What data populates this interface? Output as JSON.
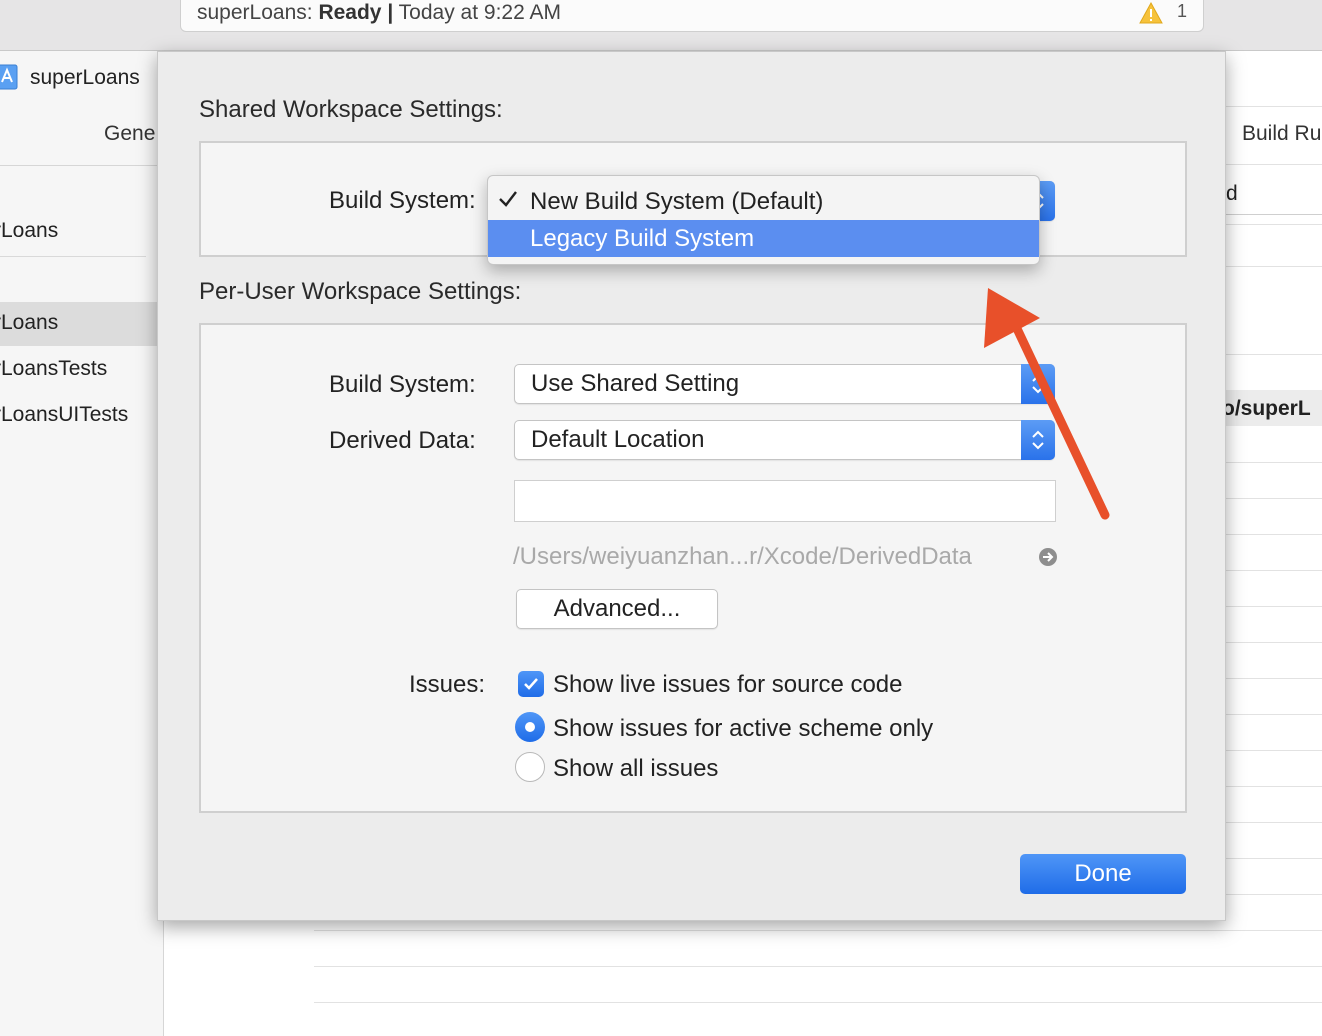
{
  "activity": {
    "project": "superLoans:",
    "status": "Ready",
    "separator": "|",
    "time": "Today at 9:22 AM",
    "warning_count": "1",
    "warning_icon": "warning-triangle-icon"
  },
  "project_nav": {
    "project_name": "superLoans",
    "tab_general": "Gene",
    "items": [
      {
        "label": "rLoans"
      },
      {
        "label": "rLoans"
      },
      {
        "label": "rLoansTests"
      },
      {
        "label": "rLoansUITests"
      }
    ]
  },
  "editor_right": {
    "tab_build_rules": "Build Ru",
    "field_fragment": "d",
    "path_fragment": "o/superL"
  },
  "sheet": {
    "shared_title": "Shared Workspace Settings:",
    "shared_build_system_label": "Build System:",
    "build_system_menu": {
      "options": [
        {
          "label": "New Build System (Default)",
          "checked": true
        },
        {
          "label": "Legacy Build System",
          "highlighted": true
        }
      ]
    },
    "per_user_title": "Per-User Workspace Settings:",
    "user_build_system_label": "Build System:",
    "user_build_system_value": "Use Shared Setting",
    "derived_data_label": "Derived Data:",
    "derived_data_value": "Default Location",
    "custom_path_value": "",
    "derived_path": "/Users/weiyuanzhan...r/Xcode/DerivedData",
    "advanced_button": "Advanced...",
    "issues_label": "Issues:",
    "live_issues_label": "Show live issues for source code",
    "live_issues_checked": true,
    "scheme_only_label": "Show issues for active scheme only",
    "all_issues_label": "Show all issues",
    "issues_selected": "active-scheme-only",
    "done_button": "Done"
  },
  "colors": {
    "accent": "#2a72ea",
    "menu_highlight": "#5b8ef0",
    "annotation_arrow": "#e8502a"
  }
}
